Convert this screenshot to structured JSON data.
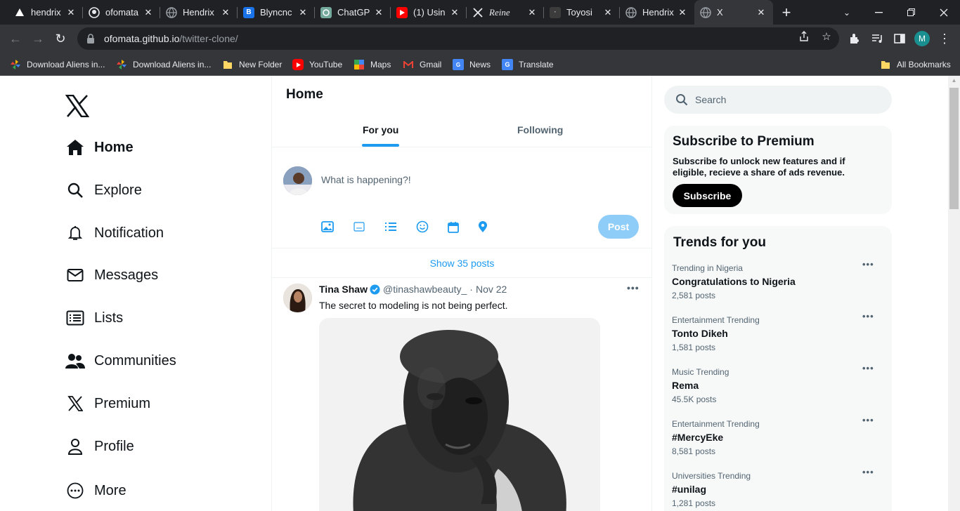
{
  "browser": {
    "tabs": [
      {
        "title": "hendrix",
        "favicon": "triangle-icon"
      },
      {
        "title": "ofomata",
        "favicon": "github-icon"
      },
      {
        "title": "Hendrix",
        "favicon": "globe-icon"
      },
      {
        "title": "Blyncnc",
        "favicon": "b-icon"
      },
      {
        "title": "ChatGP",
        "favicon": "chatgpt-icon"
      },
      {
        "title": "(1) Usin",
        "favicon": "youtube-icon"
      },
      {
        "title": "Reine",
        "favicon": "x-icon"
      },
      {
        "title": "Toyosi",
        "favicon": "toyosi-icon"
      },
      {
        "title": "Hendrix",
        "favicon": "globe-icon"
      },
      {
        "title": "X",
        "favicon": "globe-icon"
      }
    ],
    "url": {
      "domain": "ofomata.github.io",
      "path": "/twitter-clone/"
    },
    "profile_initial": "M",
    "bookmarks": [
      {
        "label": "Download Aliens in...",
        "icon": "pinwheel-icon"
      },
      {
        "label": "Download Aliens in...",
        "icon": "pinwheel-icon"
      },
      {
        "label": "New Folder",
        "icon": "folder-icon"
      },
      {
        "label": "YouTube",
        "icon": "youtube-icon"
      },
      {
        "label": "Maps",
        "icon": "maps-icon"
      },
      {
        "label": "Gmail",
        "icon": "gmail-icon"
      },
      {
        "label": "News",
        "icon": "news-icon"
      },
      {
        "label": "Translate",
        "icon": "translate-icon"
      }
    ],
    "all_bookmarks": "All Bookmarks"
  },
  "sidebar": {
    "items": [
      {
        "label": "Home",
        "icon": "home-icon"
      },
      {
        "label": "Explore",
        "icon": "search-icon"
      },
      {
        "label": "Notification",
        "icon": "bell-icon"
      },
      {
        "label": "Messages",
        "icon": "envelope-icon"
      },
      {
        "label": "Lists",
        "icon": "list-icon"
      },
      {
        "label": "Communities",
        "icon": "people-icon"
      },
      {
        "label": "Premium",
        "icon": "x-icon"
      },
      {
        "label": "Profile",
        "icon": "person-icon"
      },
      {
        "label": "More",
        "icon": "more-circle-icon"
      }
    ]
  },
  "main": {
    "title": "Home",
    "tabs": [
      {
        "label": "For you"
      },
      {
        "label": "Following"
      }
    ],
    "compose": {
      "placeholder": "What is happening?!",
      "post_label": "Post",
      "icons": [
        "image-icon",
        "gif-icon",
        "poll-icon",
        "emoji-icon",
        "schedule-icon",
        "location-icon"
      ]
    },
    "show_posts": "Show 35 posts",
    "tweet": {
      "name": "Tina Shaw",
      "handle": "@tinashawbeauty_",
      "dot": "·",
      "date": "Nov 22",
      "text": "The secret to modeling is not being perfect."
    }
  },
  "right": {
    "search_placeholder": "Search",
    "premium": {
      "title": "Subscribe to Premium",
      "text": "Subscribe fo unlock new features and if eligible, recieve a share of ads revenue.",
      "button": "Subscribe"
    },
    "trends_title": "Trends for you",
    "trends": [
      {
        "category": "Trending in Nigeria",
        "name": "Congratulations to Nigeria",
        "posts": "2,581 posts"
      },
      {
        "category": "Entertainment Trending",
        "name": "Tonto Dikeh",
        "posts": "1,581 posts"
      },
      {
        "category": "Music Trending",
        "name": "Rema",
        "posts": "45.5K posts"
      },
      {
        "category": "Entertainment Trending",
        "name": "#MercyEke",
        "posts": "8,581 posts"
      },
      {
        "category": "Universities Trending",
        "name": "#unilag",
        "posts": "1,281 posts"
      }
    ]
  },
  "colors": {
    "accent": "#1d9bf0",
    "post_button": "#8ecdf8",
    "text": "#0f1419",
    "muted": "#536471"
  }
}
